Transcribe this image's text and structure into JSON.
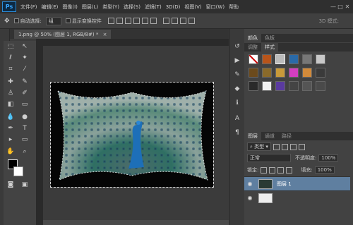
{
  "app": {
    "logo": "Ps"
  },
  "menu": [
    "文件(F)",
    "编辑(E)",
    "图像(I)",
    "图层(L)",
    "类型(Y)",
    "选择(S)",
    "滤镜(T)",
    "3D(D)",
    "视图(V)",
    "窗口(W)",
    "帮助"
  ],
  "window_controls": [
    "—",
    "□",
    "✕"
  ],
  "options": {
    "auto_select_label": "自动选择:",
    "auto_select_value": "组",
    "show_transform_label": "显示变换控件",
    "mode_3d_label": "3D 模式:"
  },
  "document": {
    "tab_label": "1.png @ 50% (图层 1, RGB/8#) *",
    "close": "×"
  },
  "panels": {
    "top_tabs": [
      "颜色",
      "色板"
    ],
    "mid_tabs": [
      "调整",
      "样式"
    ],
    "layers_tabs": [
      "图层",
      "通道",
      "路径"
    ],
    "kind_label": "类型",
    "blend_mode": "正常",
    "opacity_label": "不透明度:",
    "opacity_value": "100%",
    "lock_label": "锁定:",
    "fill_label": "填充:",
    "fill_value": "100%",
    "layers": [
      {
        "name": "图层 1",
        "selected": true
      },
      {
        "name": "",
        "selected": false
      }
    ]
  },
  "colors": {
    "accent": "#2b8bd6",
    "selected_layer": "#5f7fa0"
  }
}
